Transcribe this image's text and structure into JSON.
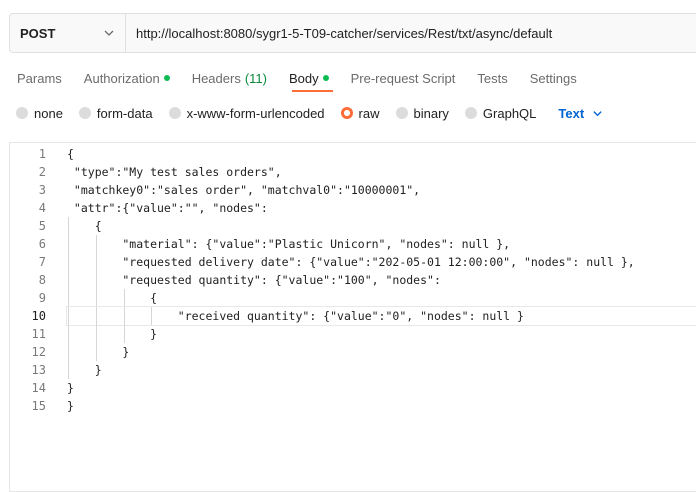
{
  "request": {
    "method": "POST",
    "url": "http://localhost:8080/sygr1-5-T09-catcher/services/Rest/txt/async/default"
  },
  "tabs": [
    {
      "label": "Params"
    },
    {
      "label": "Authorization"
    },
    {
      "label": "Headers",
      "count": "(11)"
    },
    {
      "label": "Body"
    },
    {
      "label": "Pre-request Script"
    },
    {
      "label": "Tests"
    },
    {
      "label": "Settings"
    }
  ],
  "body_types": [
    "none",
    "form-data",
    "x-www-form-urlencoded",
    "raw",
    "binary",
    "GraphQL"
  ],
  "selected_body_type": "raw",
  "language": "Text",
  "editor": {
    "line_numbers": [
      "1",
      "2",
      "3",
      "4",
      "5",
      "6",
      "7",
      "8",
      "9",
      "10",
      "11",
      "12",
      "13",
      "14",
      "15"
    ],
    "current_line": 10,
    "lines": [
      "{",
      " \"type\":\"My test sales orders\",",
      " \"matchkey0\":\"sales order\", \"matchval0\":\"10000001\",",
      " \"attr\":{\"value\":\"\", \"nodes\":",
      "    {",
      "        \"material\": {\"value\":\"Plastic Unicorn\", \"nodes\": null },",
      "        \"requested delivery date\": {\"value\":\"202-05-01 12:00:00\", \"nodes\": null },",
      "        \"requested quantity\": {\"value\":\"100\", \"nodes\":",
      "            {",
      "                \"received quantity\": {\"value\":\"0\", \"nodes\": null }",
      "            }",
      "        }",
      "    }",
      "}",
      "}"
    ]
  },
  "colors": {
    "accent": "#ff6c37",
    "status_dot": "#0cbb52",
    "link": "#0265d2"
  }
}
